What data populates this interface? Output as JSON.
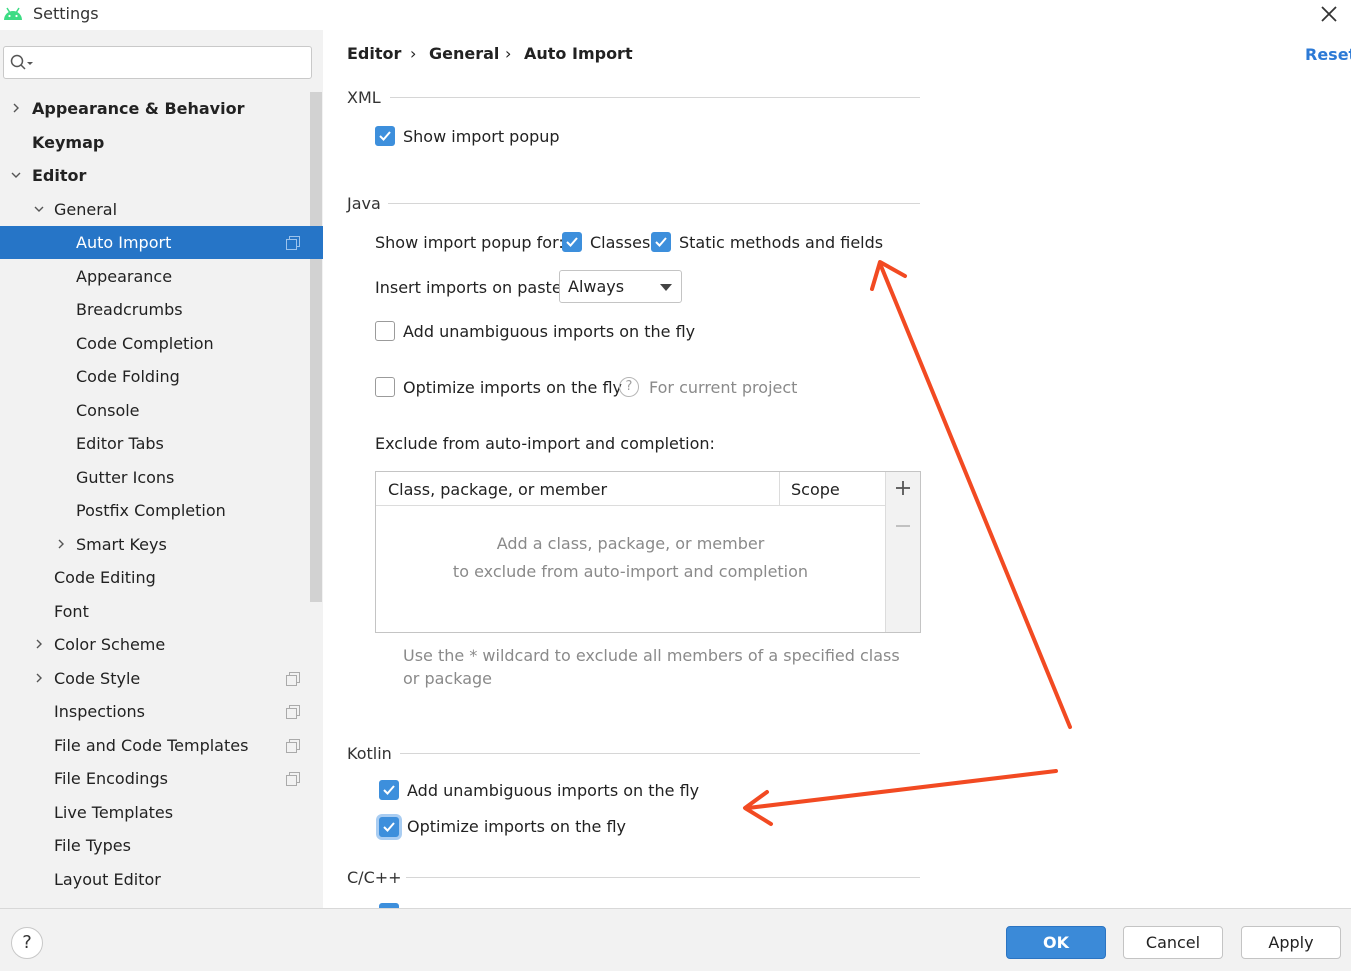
{
  "window": {
    "title": "Settings"
  },
  "search": {
    "value": "",
    "placeholder": ""
  },
  "sidebar": {
    "items": [
      {
        "label": "Appearance & Behavior"
      },
      {
        "label": "Keymap"
      },
      {
        "label": "Editor"
      },
      {
        "label": "General"
      },
      {
        "label": "Auto Import"
      },
      {
        "label": "Appearance"
      },
      {
        "label": "Breadcrumbs"
      },
      {
        "label": "Code Completion"
      },
      {
        "label": "Code Folding"
      },
      {
        "label": "Console"
      },
      {
        "label": "Editor Tabs"
      },
      {
        "label": "Gutter Icons"
      },
      {
        "label": "Postfix Completion"
      },
      {
        "label": "Smart Keys"
      },
      {
        "label": "Code Editing"
      },
      {
        "label": "Font"
      },
      {
        "label": "Color Scheme"
      },
      {
        "label": "Code Style"
      },
      {
        "label": "Inspections"
      },
      {
        "label": "File and Code Templates"
      },
      {
        "label": "File Encodings"
      },
      {
        "label": "Live Templates"
      },
      {
        "label": "File Types"
      },
      {
        "label": "Layout Editor"
      }
    ]
  },
  "breadcrumb": {
    "items": [
      "Editor",
      "General",
      "Auto Import"
    ]
  },
  "reset_label": "Reset",
  "xml": {
    "title": "XML",
    "show_import_popup": {
      "label": "Show import popup",
      "checked": true
    }
  },
  "java": {
    "title": "Java",
    "show_popup_for_label": "Show import popup for:",
    "classes": {
      "label": "Classes",
      "checked": true
    },
    "static": {
      "label": "Static methods and fields",
      "checked": true
    },
    "insert_on_paste_label": "Insert imports on paste:",
    "insert_on_paste_value": "Always",
    "add_unambiguous": {
      "label": "Add unambiguous imports on the fly",
      "checked": false
    },
    "optimize": {
      "label": "Optimize imports on the fly",
      "checked": false
    },
    "for_current_project": "For current project",
    "exclude_label": "Exclude from auto-import and completion:",
    "table": {
      "columns": [
        "Class, package, or member",
        "Scope"
      ],
      "empty_line1": "Add a class, package, or member",
      "empty_line2": "to exclude from auto-import and completion"
    },
    "wildcard_note": "Use the * wildcard to exclude all members of a specified class or package"
  },
  "kotlin": {
    "title": "Kotlin",
    "add_unambiguous": {
      "label": "Add unambiguous imports on the fly",
      "checked": true
    },
    "optimize": {
      "label": "Optimize imports on the fly",
      "checked": true
    }
  },
  "cpp": {
    "title": "C/C++"
  },
  "buttons": {
    "ok": "OK",
    "cancel": "Cancel",
    "apply": "Apply",
    "help": "?"
  },
  "colors": {
    "accent": "#2675c7",
    "checkbox": "#3d8fdc",
    "annotation_arrow": "#f24a22",
    "link": "#2c7ad6"
  }
}
